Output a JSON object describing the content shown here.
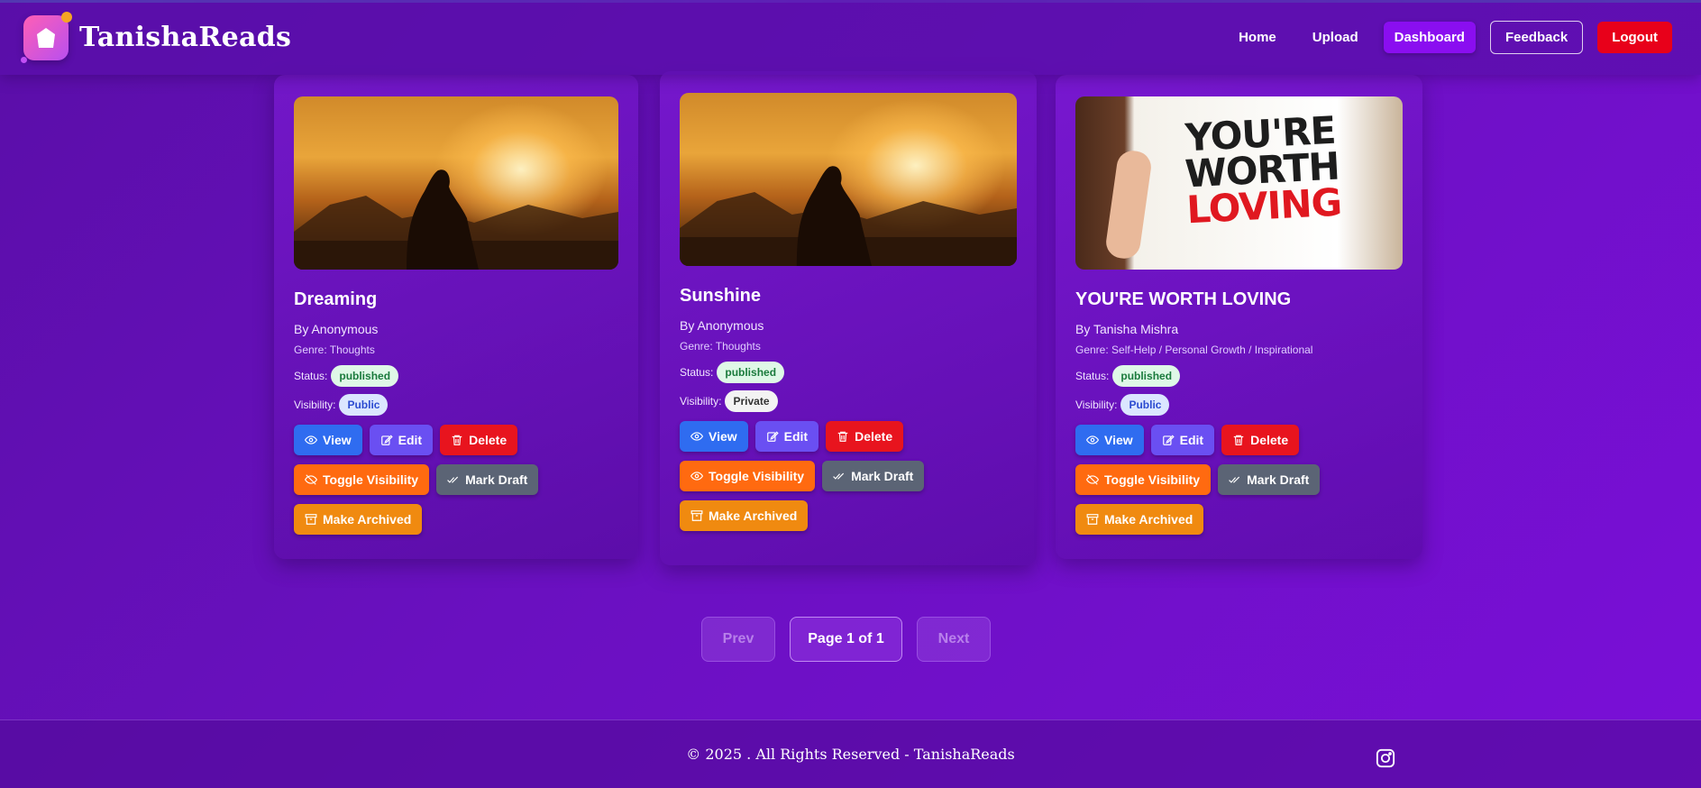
{
  "brand": {
    "name": "TanishaReads"
  },
  "nav": {
    "home": "Home",
    "upload": "Upload",
    "dashboard": "Dashboard",
    "feedback": "Feedback",
    "logout": "Logout"
  },
  "labels": {
    "status": "Status:",
    "visibility": "Visibility:",
    "view": "View",
    "edit": "Edit",
    "delete": "Delete",
    "toggle_visibility": "Toggle Visibility",
    "mark_draft": "Mark Draft",
    "make_archived": "Make Archived"
  },
  "cards": [
    {
      "title": "Dreaming",
      "author": "By Anonymous",
      "genre": "Genre: Thoughts",
      "status": "published",
      "visibility": "Public",
      "image": "sunset-silhouette"
    },
    {
      "title": "Sunshine",
      "author": "By Anonymous",
      "genre": "Genre: Thoughts",
      "status": "published",
      "visibility": "Private",
      "image": "sunset-silhouette"
    },
    {
      "title": "YOU'RE WORTH LOVING",
      "author": "By Tanisha Mishra",
      "genre": "Genre: Self-Help / Personal Growth / Inspirational",
      "status": "published",
      "visibility": "Public",
      "image": "youre-worth-loving-sign",
      "poster_lines": [
        "YOU'RE",
        "WORTH",
        "LOVING"
      ]
    }
  ],
  "pagination": {
    "prev": "Prev",
    "page": "Page 1 of 1",
    "next": "Next"
  },
  "footer": {
    "copyright": "© 2025 . All Rights Reserved - TanishaReads",
    "social_icon": "instagram-icon"
  },
  "colors": {
    "background": "#6a10c0",
    "dashboard_active": "#8a0ef0",
    "logout": "#e8001a",
    "view": "#2f6cf0",
    "edit": "#6a4ff2",
    "delete": "#e8141e",
    "toggle": "#ff6a10",
    "draft": "#5b6475",
    "archive": "#f08a10"
  }
}
